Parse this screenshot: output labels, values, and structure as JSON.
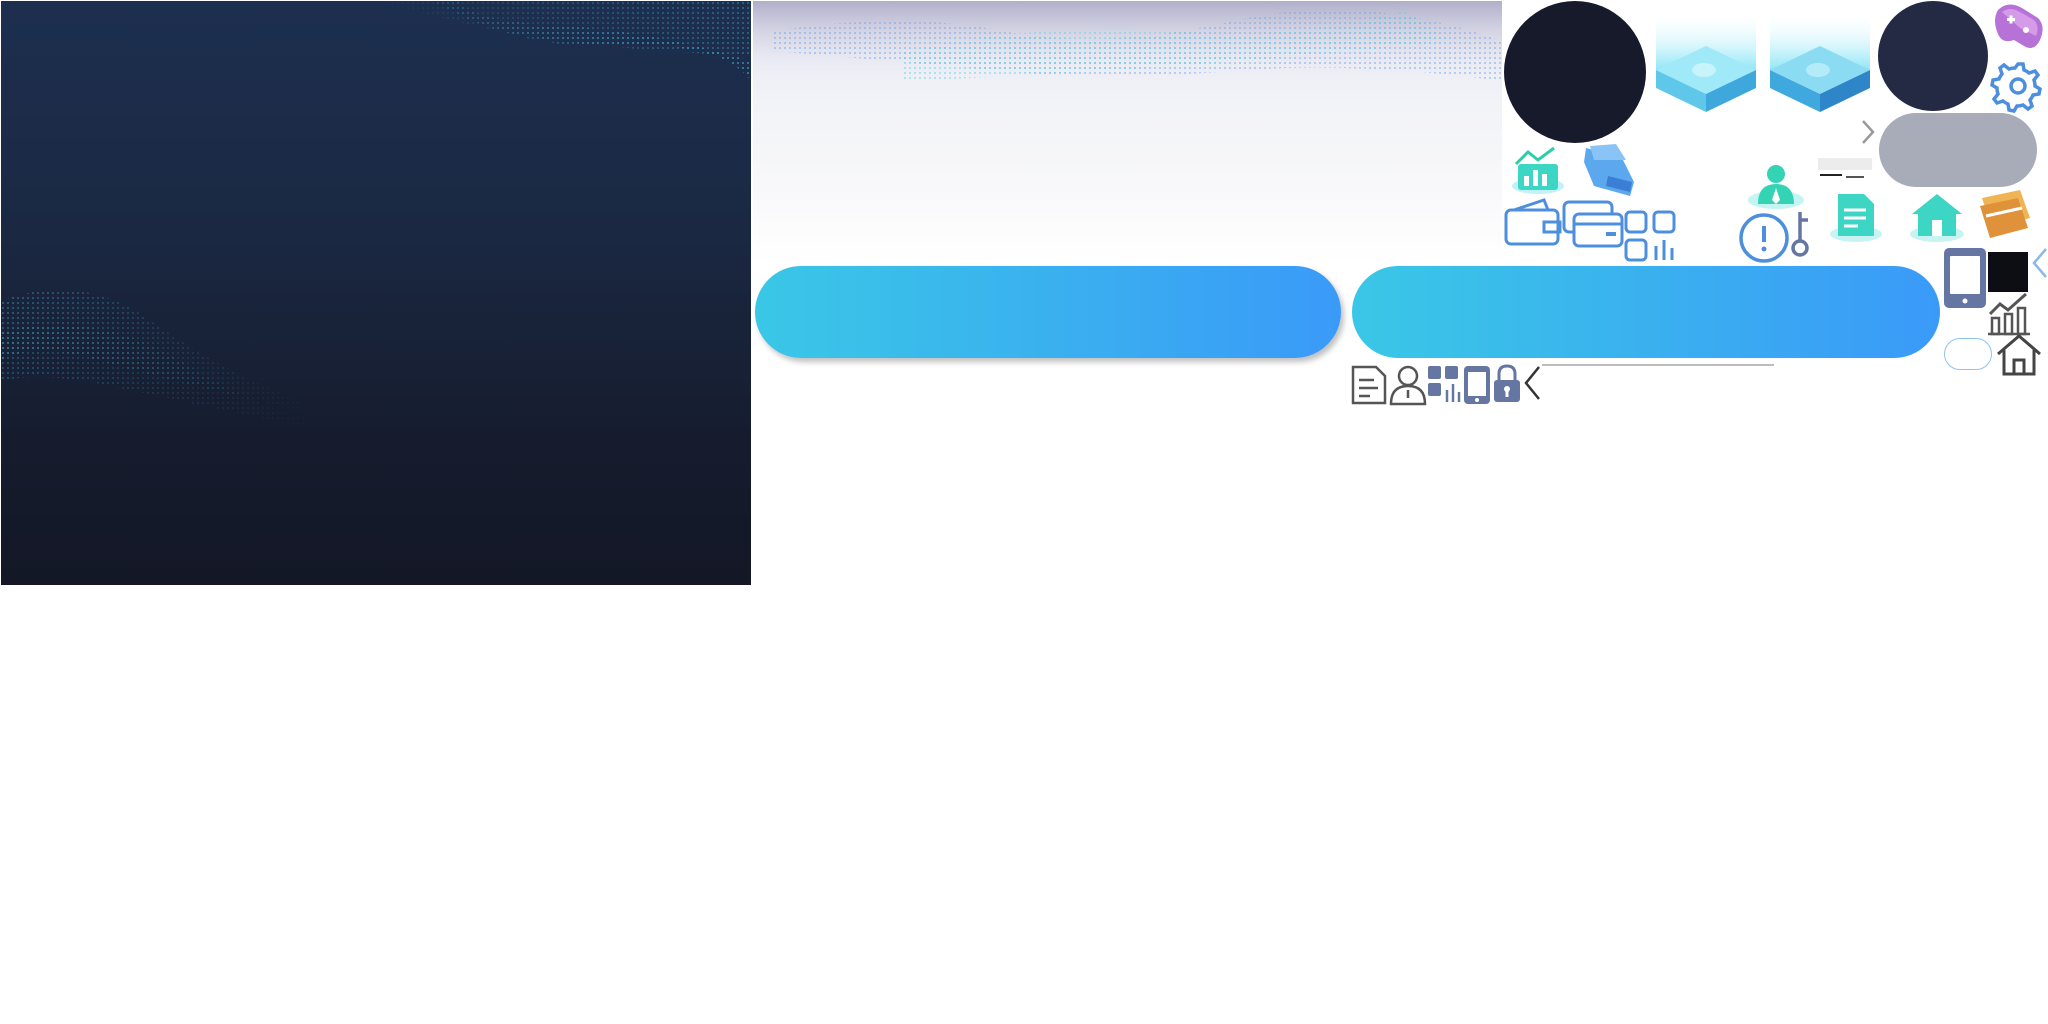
{
  "sheet": {
    "description_colors": {
      "dark_bg_top": "#1d2f4f",
      "dark_bg_bottom": "#131726",
      "pill_gradient_start": "#3ac7e6",
      "pill_gradient_end": "#3a9af8",
      "gray_pill": "#a8abb8",
      "icon_slate": "#6576a3",
      "icon_blue": "#4e8fdd"
    },
    "icons": [
      "analytics-iso-icon",
      "wallet-iso-icon",
      "wallet-outline-icon",
      "cards-outline-icon",
      "apps-grid-icon",
      "alert-circle-icon",
      "key-icon",
      "user-iso-icon",
      "document-iso-icon",
      "home-iso-icon",
      "credit-card-iso-icon",
      "gamepad-iso-icon",
      "gear-icon",
      "chevron-right-icon",
      "chevron-left-icon",
      "tablet-icon",
      "bar-chart-outline-icon",
      "home-outline-icon",
      "document-outline-icon",
      "user-outline-icon",
      "grid-chart-icon",
      "phone-icon",
      "lock-icon",
      "back-arrow-icon"
    ]
  }
}
